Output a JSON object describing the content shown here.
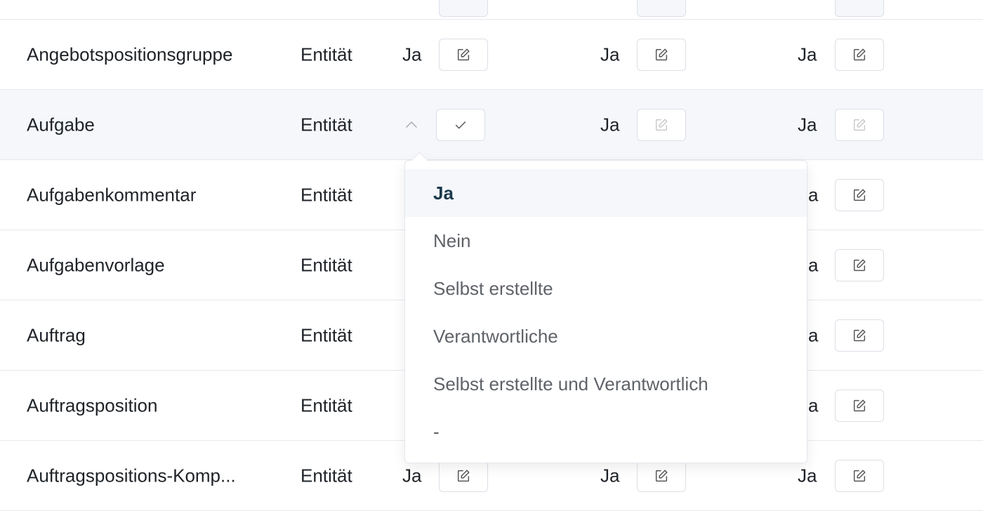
{
  "rows": [
    {
      "name": "",
      "type": "",
      "perm1": "",
      "perm2": "",
      "perm3": ""
    },
    {
      "name": "Angebotspositionsgruppe",
      "type": "Entität",
      "perm1": "Ja",
      "perm2": "Ja",
      "perm3": "Ja"
    },
    {
      "name": "Aufgabe",
      "type": "Entität",
      "perm1": "",
      "perm2": "Ja",
      "perm3": "Ja"
    },
    {
      "name": "Aufgabenkommentar",
      "type": "Entität",
      "perm1": "",
      "perm2": "",
      "perm3": "a"
    },
    {
      "name": "Aufgabenvorlage",
      "type": "Entität",
      "perm1": "",
      "perm2": "",
      "perm3": "a"
    },
    {
      "name": "Auftrag",
      "type": "Entität",
      "perm1": "",
      "perm2": "",
      "perm3": "a"
    },
    {
      "name": "Auftragsposition",
      "type": "Entität",
      "perm1": "",
      "perm2": "",
      "perm3": "a"
    },
    {
      "name": "Auftragspositions-Komp...",
      "type": "Entität",
      "perm1": "Ja",
      "perm2": "Ja",
      "perm3": "Ja"
    }
  ],
  "dropdown": {
    "options": [
      "Ja",
      "Nein",
      "Selbst erstellte",
      "Verantwortliche",
      "Selbst erstellte und Verantwortlich",
      "-"
    ],
    "selected": "Ja"
  },
  "colors": {
    "row_border": "#e6e8ec",
    "active_row_bg": "#f5f7fb",
    "selected_option_text": "#1b3a4b",
    "option_text": "#5f6368",
    "button_border": "#dcdfe6"
  },
  "icons": {
    "edit": "edit-icon",
    "confirm": "check-icon",
    "collapse": "chevron-up-icon"
  }
}
